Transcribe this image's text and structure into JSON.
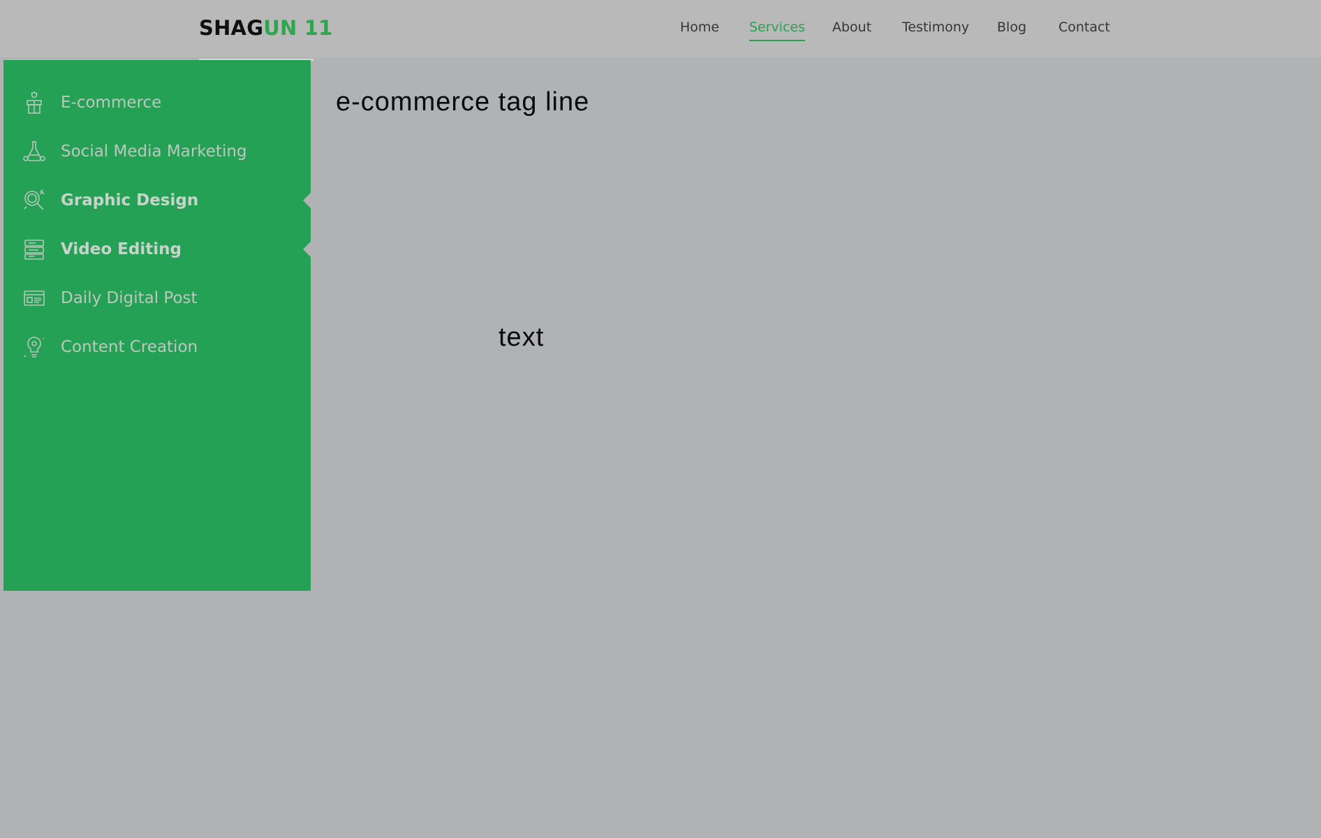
{
  "brand": {
    "part1": "SHAG",
    "part2": "UN 11"
  },
  "nav": [
    {
      "label": "Home",
      "active": false
    },
    {
      "label": "Services",
      "active": true
    },
    {
      "label": "About",
      "active": false
    },
    {
      "label": "Testimony",
      "active": false
    },
    {
      "label": "Blog",
      "active": false
    },
    {
      "label": "Contact",
      "active": false
    }
  ],
  "sidebar": {
    "items": [
      {
        "label": "E-commerce",
        "icon": "gift-box-icon",
        "bold": false,
        "selected": false
      },
      {
        "label": "Social Media Marketing",
        "icon": "lab-flask-icon",
        "bold": false,
        "selected": false
      },
      {
        "label": "Graphic Design",
        "icon": "magnifier-analytics-icon",
        "bold": true,
        "selected": true
      },
      {
        "label": "Video Editing",
        "icon": "video-stack-icon",
        "bold": true,
        "selected": true
      },
      {
        "label": "Daily Digital Post",
        "icon": "card-list-icon",
        "bold": false,
        "selected": false
      },
      {
        "label": "Content Creation",
        "icon": "idea-bulb-icon",
        "bold": false,
        "selected": false
      }
    ]
  },
  "content": {
    "title": "e-commerce tag line",
    "text": "text"
  },
  "colors": {
    "accent": "#2c9f51",
    "sidebar_bg": "#25a155",
    "page_bg": "#b1b2b4",
    "navbar_bg": "#b9b9b9"
  }
}
